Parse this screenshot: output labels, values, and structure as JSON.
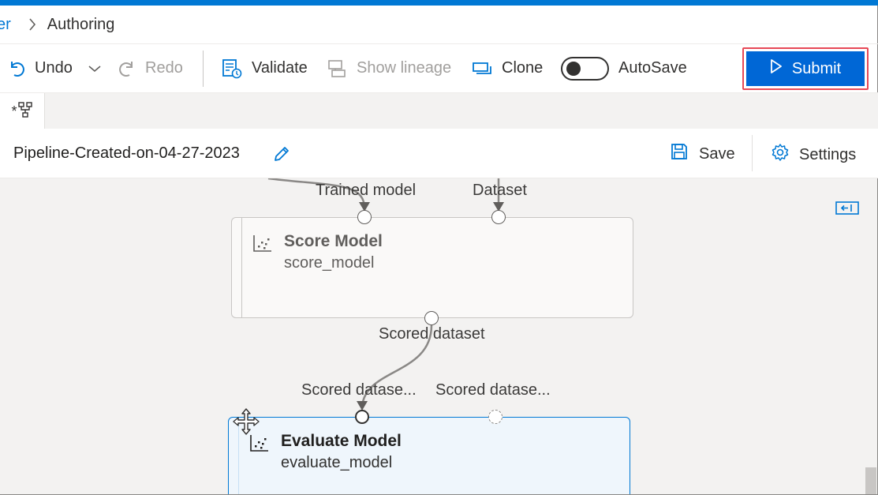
{
  "breadcrumb": {
    "previous": "er",
    "current": "Authoring"
  },
  "toolbar": {
    "undo_label": "Undo",
    "redo_label": "Redo",
    "validate_label": "Validate",
    "show_lineage_label": "Show lineage",
    "clone_label": "Clone",
    "autosave_label": "AutoSave",
    "autosave_on": false,
    "submit_label": "Submit"
  },
  "tabs": [
    {
      "label": "*",
      "icon": "pipeline-icon"
    }
  ],
  "pipeline": {
    "title": "Pipeline-Created-on-04-27-2023",
    "save_label": "Save",
    "settings_label": "Settings"
  },
  "canvas": {
    "score_model": {
      "title": "Score Model",
      "subtitle": "score_model",
      "input_ports": [
        "Trained model",
        "Dataset"
      ],
      "output_port": "Scored dataset"
    },
    "evaluate_model": {
      "title": "Evaluate Model",
      "subtitle": "evaluate_model",
      "input_ports": [
        "Scored datase...",
        "Scored datase..."
      ]
    }
  },
  "colors": {
    "accent": "#0078d4",
    "submit_bg": "#0067d6",
    "submit_highlight": "#e74856",
    "canvas_bg": "#f3f2f1"
  }
}
